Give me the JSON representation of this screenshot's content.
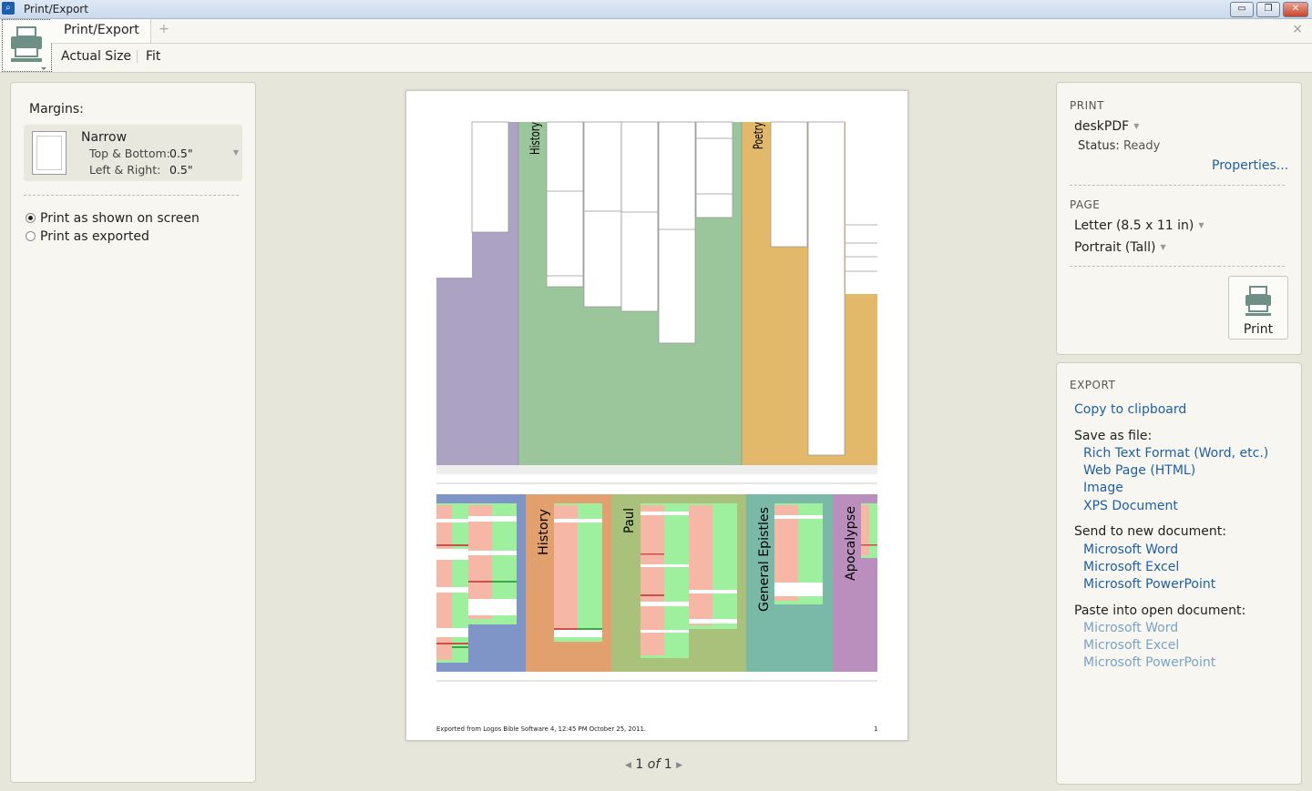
{
  "window": {
    "title": "Print/Export",
    "minimize_icon": "minimize-icon",
    "restore_icon": "restore-icon",
    "close_icon": "close-icon"
  },
  "tabs": {
    "active_label": "Print/Export",
    "add_icon": "+",
    "close_icon": "×"
  },
  "zoom": {
    "actual_size": "Actual Size",
    "fit": "Fit"
  },
  "margins": {
    "label": "Margins:",
    "preset": "Narrow",
    "top_bottom_label": "Top & Bottom:",
    "top_bottom_value": "0.5\"",
    "left_right_label": "Left & Right:",
    "left_right_value": "0.5\""
  },
  "print_mode": {
    "options": [
      "Print as shown on screen",
      "Print as exported"
    ],
    "selected": 0
  },
  "preview": {
    "footer_text": "Exported from Logos Bible Software 4, 12:45 PM October 25, 2011.",
    "page_number": "1",
    "pager": {
      "current": "1",
      "of_label": "of",
      "total": "1"
    },
    "top_chart_labels": [
      "History",
      "Poetry"
    ],
    "bottom_chart_labels": [
      "History",
      "Paul",
      "General Epistles",
      "Apocalypse"
    ],
    "colors": {
      "purple": "#aca2c4",
      "green": "#9bc59b",
      "gold": "#e2b86a",
      "blue": "#7f95c7",
      "orange": "#e2a06e",
      "olive": "#a9c17a",
      "teal": "#7ab9a7",
      "violet": "#bb8fbd"
    }
  },
  "print": {
    "heading": "PRINT",
    "printer": "deskPDF",
    "status_label": "Status:",
    "status_value": "Ready",
    "properties_link": "Properties...",
    "page_heading": "PAGE",
    "paper_size": "Letter (8.5 x 11 in)",
    "orientation": "Portrait (Tall)",
    "print_button": "Print"
  },
  "export": {
    "heading": "EXPORT",
    "copy_clipboard": "Copy to clipboard",
    "save_as_file_label": "Save as file:",
    "save_as": [
      "Rich Text Format (Word, etc.)",
      "Web Page (HTML)",
      "Image",
      "XPS Document"
    ],
    "send_to_label": "Send to new document:",
    "send_to": [
      "Microsoft Word",
      "Microsoft Excel",
      "Microsoft PowerPoint"
    ],
    "paste_into_label": "Paste into open document:",
    "paste_into": [
      "Microsoft Word",
      "Microsoft Excel",
      "Microsoft PowerPoint"
    ]
  }
}
